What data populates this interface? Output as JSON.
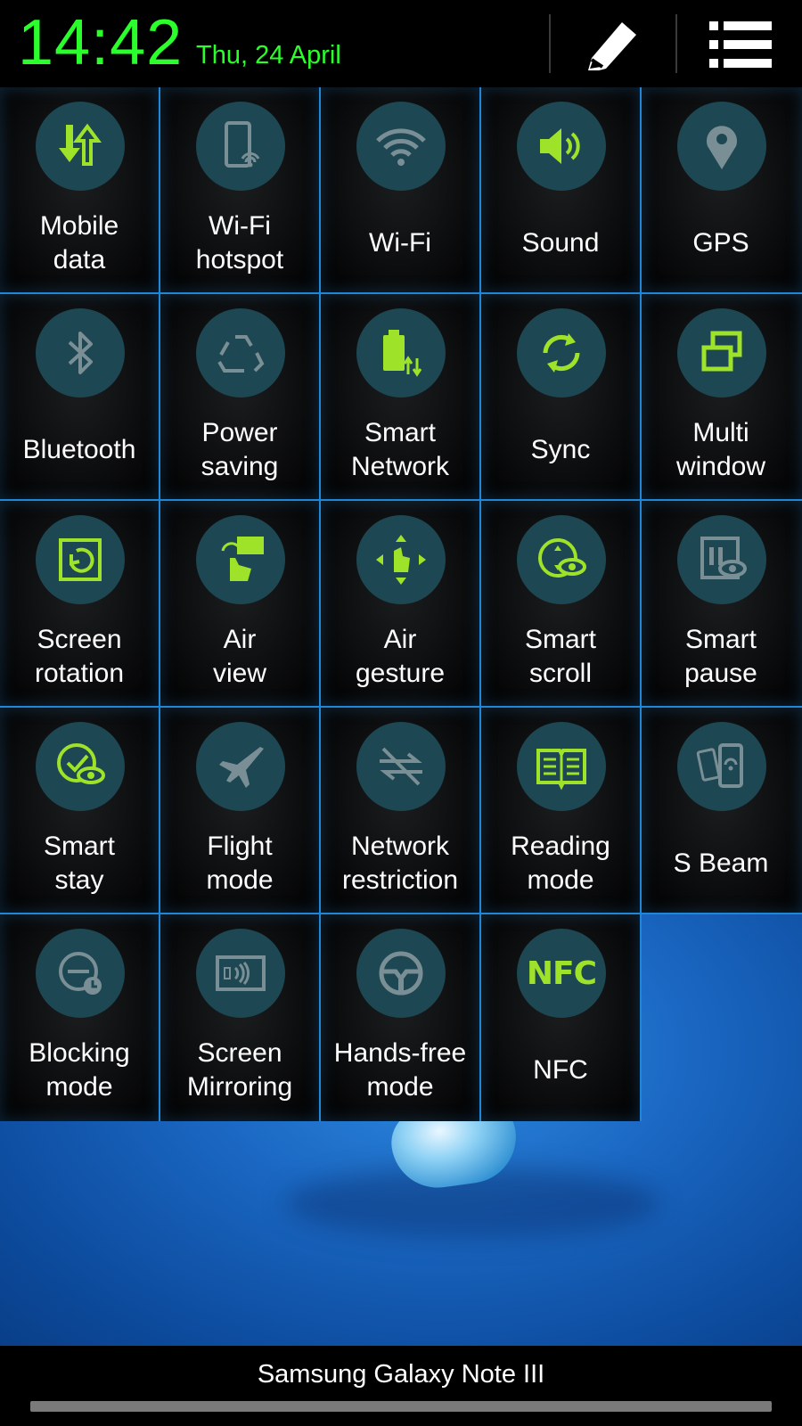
{
  "status": {
    "time": "14:42",
    "date": "Thu, 24 April"
  },
  "header": {
    "edit_icon": "pencil-icon",
    "menu_icon": "list-icon"
  },
  "colors": {
    "accent_green": "#2bff2b",
    "active_icon": "#9fe22a",
    "inactive_icon": "#7a8f95",
    "tile_border": "#1f86d8",
    "icon_circle": "#1d4752"
  },
  "toggles": [
    {
      "label": "Mobile\ndata",
      "icon": "mobile-data-icon",
      "active": true
    },
    {
      "label": "Wi-Fi\nhotspot",
      "icon": "wifi-hotspot-icon",
      "active": false
    },
    {
      "label": "Wi-Fi",
      "icon": "wifi-icon",
      "active": false
    },
    {
      "label": "Sound",
      "icon": "sound-icon",
      "active": true
    },
    {
      "label": "GPS",
      "icon": "gps-icon",
      "active": false
    },
    {
      "label": "Bluetooth",
      "icon": "bluetooth-icon",
      "active": false
    },
    {
      "label": "Power\nsaving",
      "icon": "power-saving-icon",
      "active": false
    },
    {
      "label": "Smart\nNetwork",
      "icon": "smart-network-icon",
      "active": true
    },
    {
      "label": "Sync",
      "icon": "sync-icon",
      "active": true
    },
    {
      "label": "Multi\nwindow",
      "icon": "multi-window-icon",
      "active": true
    },
    {
      "label": "Screen\nrotation",
      "icon": "screen-rotation-icon",
      "active": true
    },
    {
      "label": "Air\nview",
      "icon": "air-view-icon",
      "active": true
    },
    {
      "label": "Air\ngesture",
      "icon": "air-gesture-icon",
      "active": true
    },
    {
      "label": "Smart\nscroll",
      "icon": "smart-scroll-icon",
      "active": true
    },
    {
      "label": "Smart\npause",
      "icon": "smart-pause-icon",
      "active": false
    },
    {
      "label": "Smart\nstay",
      "icon": "smart-stay-icon",
      "active": true
    },
    {
      "label": "Flight\nmode",
      "icon": "flight-mode-icon",
      "active": false
    },
    {
      "label": "Network\nrestriction",
      "icon": "network-restriction-icon",
      "active": false
    },
    {
      "label": "Reading\nmode",
      "icon": "reading-mode-icon",
      "active": true
    },
    {
      "label": "S Beam",
      "icon": "s-beam-icon",
      "active": false
    },
    {
      "label": "Blocking\nmode",
      "icon": "blocking-mode-icon",
      "active": false
    },
    {
      "label": "Screen\nMirroring",
      "icon": "screen-mirroring-icon",
      "active": false
    },
    {
      "label": "Hands-free\nmode",
      "icon": "hands-free-mode-icon",
      "active": false
    },
    {
      "label": "NFC",
      "icon": "nfc-icon",
      "active": true,
      "icon_text": "NFC"
    }
  ],
  "footer": {
    "carrier": "Samsung Galaxy Note III"
  }
}
